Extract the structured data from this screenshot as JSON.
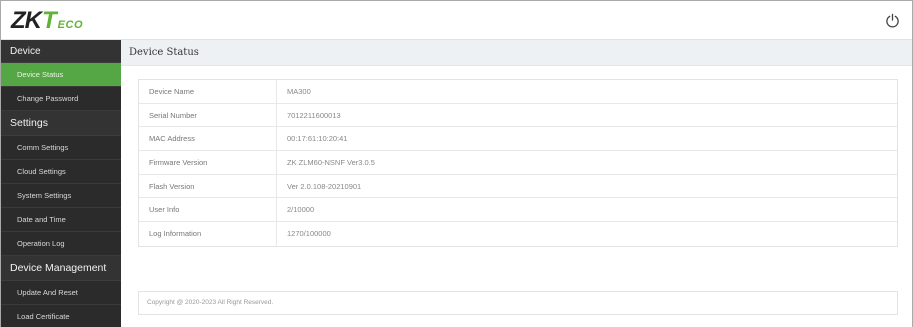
{
  "header": {
    "logo_zk": "ZK",
    "logo_t": "T",
    "logo_eco": "ECO",
    "power_icon": "power-icon"
  },
  "sidebar": {
    "sections": [
      {
        "title": "Device",
        "items": [
          {
            "label": "Device Status",
            "active": true
          },
          {
            "label": "Change Password"
          }
        ]
      },
      {
        "title": "Settings",
        "items": [
          {
            "label": "Comm Settings"
          },
          {
            "label": "Cloud Settings"
          },
          {
            "label": "System Settings"
          },
          {
            "label": "Date and Time"
          },
          {
            "label": "Operation Log"
          }
        ]
      },
      {
        "title": "Device Management",
        "items": [
          {
            "label": "Update And Reset"
          },
          {
            "label": "Load Certificate"
          }
        ]
      }
    ]
  },
  "main": {
    "title": "Device Status",
    "rows": [
      {
        "label": "Device Name",
        "value": "MA300"
      },
      {
        "label": "Serial Number",
        "value": "7012211600013"
      },
      {
        "label": "MAC Address",
        "value": "00:17:61:10:20:41"
      },
      {
        "label": "Firmware Version",
        "value": "ZK ZLM60-NSNF Ver3.0.5"
      },
      {
        "label": "Flash Version",
        "value": "Ver 2.0.108-20210901"
      },
      {
        "label": "User Info",
        "value": "2/10000"
      },
      {
        "label": "Log Information",
        "value": "1270/100000"
      }
    ],
    "copyright": "Copyright @ 2020-2023 All Right Reserved."
  },
  "colors": {
    "accent": "#55a645",
    "sidebar_bg": "#2b2b2b",
    "header_bg": "#eef1f4"
  }
}
